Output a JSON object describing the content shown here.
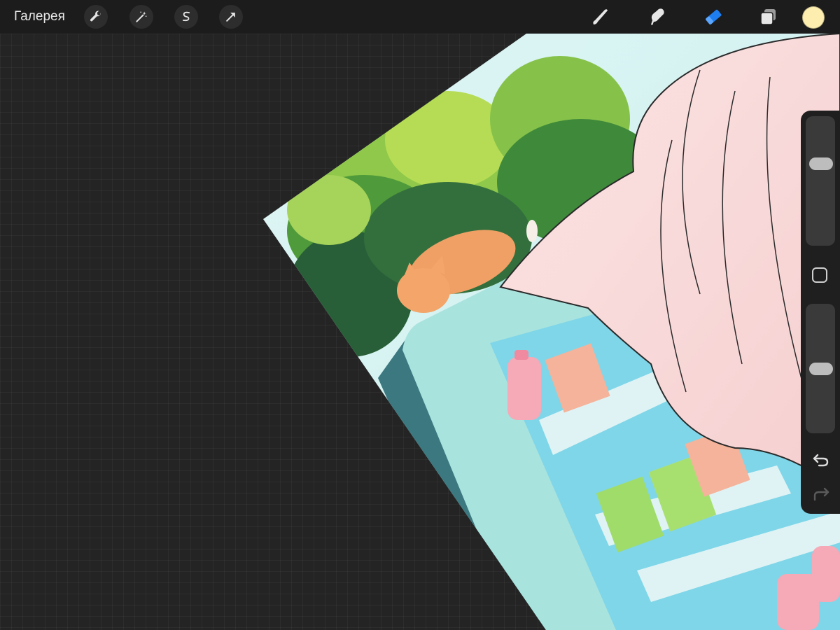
{
  "toolbar": {
    "gallery_label": "Галерея",
    "left_tools": [
      {
        "name": "wrench-icon"
      },
      {
        "name": "magic-wand-icon"
      },
      {
        "name": "selection-icon"
      },
      {
        "name": "transform-arrow-icon"
      }
    ],
    "right_tools": [
      {
        "name": "brush-icon"
      },
      {
        "name": "smudge-icon"
      },
      {
        "name": "eraser-icon",
        "active": true
      },
      {
        "name": "layers-icon"
      }
    ],
    "current_color": "#fdeeb0",
    "active_tool_color": "#1e7ef0"
  },
  "sidebar": {
    "brush_size_level": 0.66,
    "opacity_level": 0.5,
    "modifier_icon": "square-icon",
    "undo_icon": "undo-icon",
    "redo_icon": "redo-icon"
  },
  "artwork": {
    "description_icon": "illustration"
  }
}
